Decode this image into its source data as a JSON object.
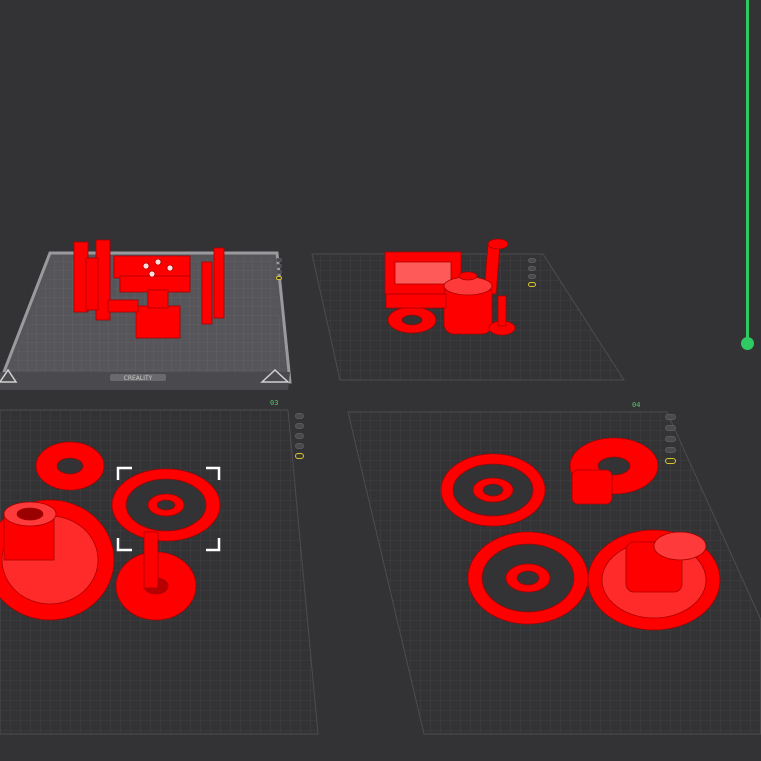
{
  "plates": [
    {
      "label": "",
      "brand": "CREALITY",
      "selected": true
    },
    {
      "label": ""
    },
    {
      "label": "03"
    },
    {
      "label": "04"
    }
  ],
  "plate_button_icons": [
    "close-icon",
    "settings-icon",
    "lock-icon",
    "arrange-icon",
    "orient-icon"
  ],
  "colors": {
    "background": "#333335",
    "grid_line": "#58585b",
    "model": "#ff0000",
    "layer_slider": "#2fcb62",
    "plate_label": "#5ac26e"
  },
  "layer_slider": {
    "position": 1.0
  }
}
